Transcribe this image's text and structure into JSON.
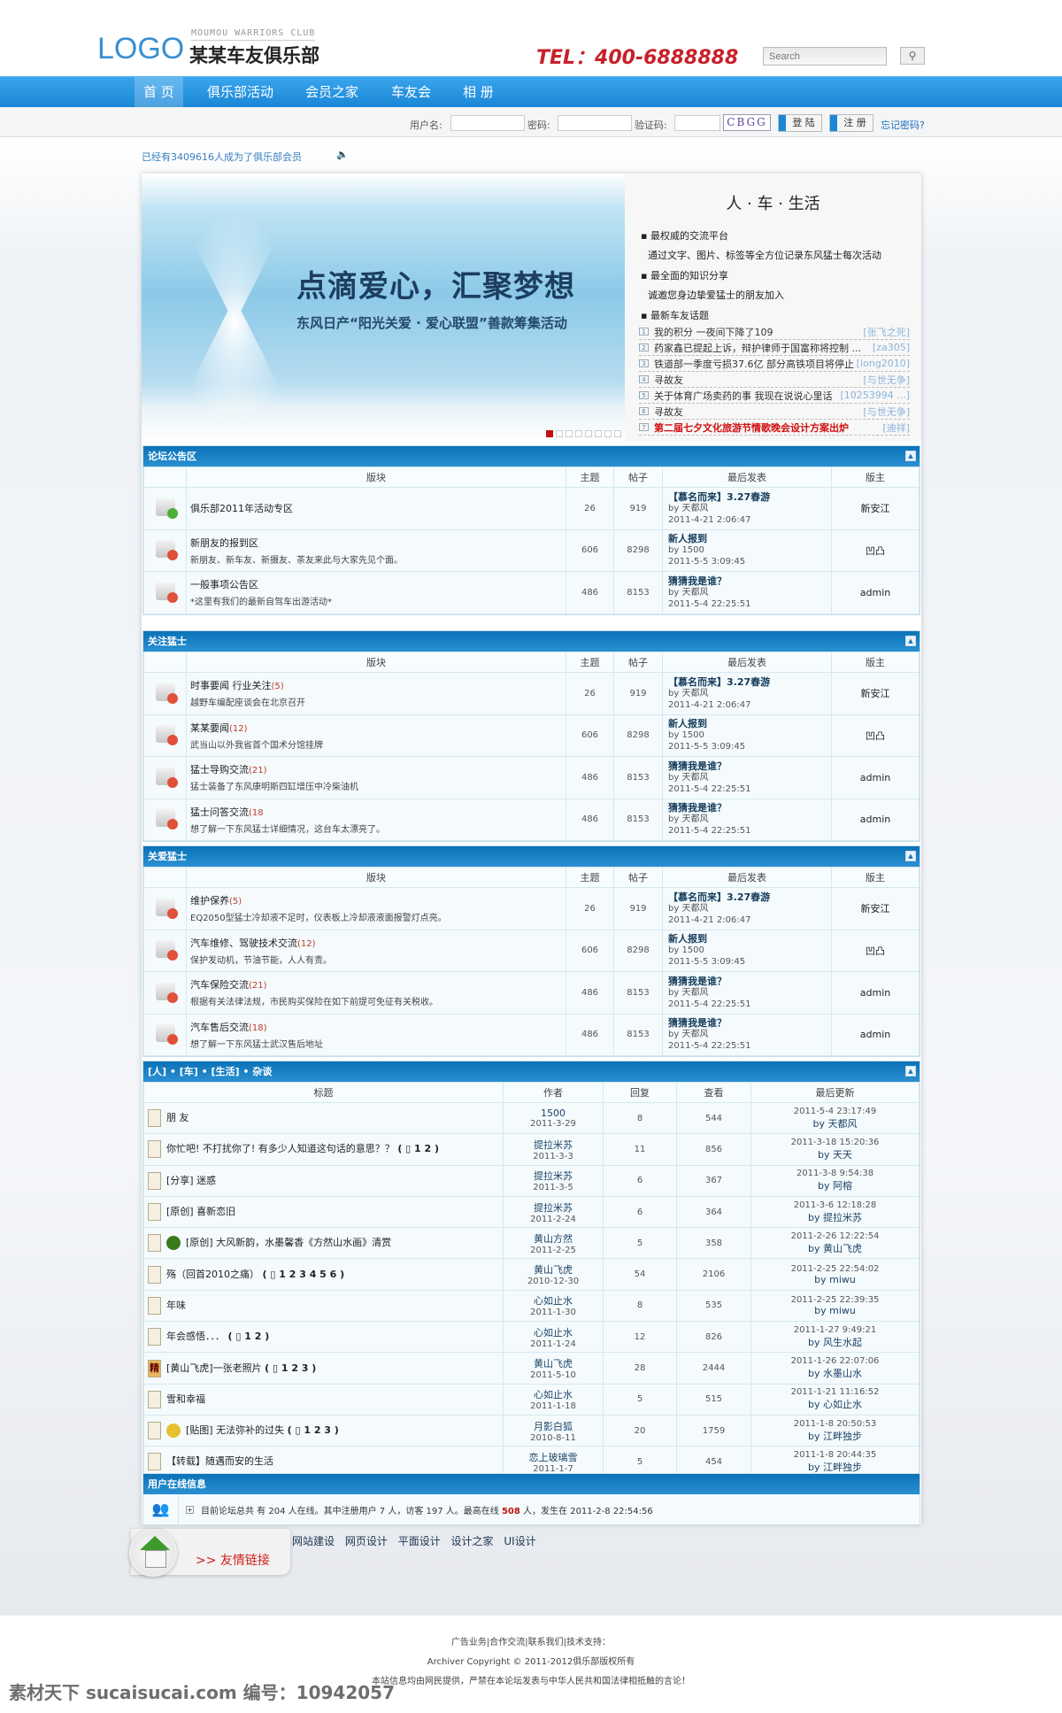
{
  "header": {
    "logo": "LOGO",
    "club_en": "MOUMOU WARRIORS CLUB",
    "club_cn": "某某车友俱乐部",
    "tel": "TEL：400-6888888",
    "search_placeholder": "Search"
  },
  "nav": [
    {
      "label": "首 页",
      "active": true
    },
    {
      "label": "俱乐部活动"
    },
    {
      "label": "会员之家"
    },
    {
      "label": "车友会"
    },
    {
      "label": "相 册"
    }
  ],
  "login": {
    "username_label": "用户名:",
    "password_label": "密码:",
    "captcha_label": "验证码:",
    "captcha": "CBGG",
    "login_btn": "登 陆",
    "register_btn": "注 册",
    "forgot": "忘记密码?"
  },
  "members_text": "已经有3409616人成为了俱乐部会员",
  "banner": {
    "title": "点滴爱心，汇聚梦想",
    "subtitle": "东风日产“阳光关爱 · 爱心联盟”善款筹集活动",
    "slides": 8,
    "active_slide": 1
  },
  "side": {
    "title": "人 · 车 · 生活",
    "b1": "最权威的交流平台",
    "t1": "通过文字、图片、标签等全方位记录东风猛士每次活动",
    "b2": "最全面的知识分享",
    "t2": "诚邀您身边挚爱猛士的朋友加入",
    "b3": "最新车友话题",
    "topics": [
      {
        "n": "1",
        "title": "我的积分 一夜间下降了109",
        "user": "[张飞之死]"
      },
      {
        "n": "2",
        "title": "药家鑫已提起上诉，辩护律师于国富称将控制 ...",
        "user": "[za305]"
      },
      {
        "n": "3",
        "title": "铁道部一季度亏损37.6亿 部分高铁项目将停止 ...",
        "user": "[long2010]"
      },
      {
        "n": "4",
        "title": "寻故友",
        "user": "[与世无争]"
      },
      {
        "n": "5",
        "title": "关于体育广场卖药的事 我现在说说心里话",
        "user": "[10253994 ...]"
      },
      {
        "n": "6",
        "title": "寻故友",
        "user": "[与世无争]"
      },
      {
        "n": "7",
        "title": "第二届七夕文化旅游节情歌晚会设计方案出炉",
        "user": "[迪祥]",
        "highlight": true
      }
    ]
  },
  "forum_headers": [
    "版块",
    "主题",
    "帖子",
    "最后发表",
    "版主"
  ],
  "sections": [
    {
      "title": "论坛公告区",
      "rows": [
        {
          "icon": "green",
          "name": "俱乐部2011年活动专区",
          "count": "",
          "desc": "",
          "topics": "26",
          "posts": "919",
          "last_title": "【慕名而来】3.27春游",
          "last_by": "by 天都风",
          "last_time": "2011-4-21 2:06:47",
          "mod": "新安江"
        },
        {
          "icon": "red",
          "name": "新朋友的报到区",
          "count": "",
          "desc": "新朋友、新车友、新摄友、茶友来此与大家先见个面。",
          "topics": "606",
          "posts": "8298",
          "last_title": "新人报到",
          "last_by": "by 1500",
          "last_time": "2011-5-5 3:09:45",
          "mod": "凹凸"
        },
        {
          "icon": "red",
          "name": "一般事项公告区",
          "count": "",
          "desc": "*这里有我们的最新自驾车出游活动*",
          "topics": "486",
          "posts": "8153",
          "last_title": "猜猜我是谁？",
          "last_by": "by 天都风",
          "last_time": "2011-5-4 22:25:51",
          "mod": "admin"
        }
      ]
    },
    {
      "title": "关注猛士",
      "rows": [
        {
          "icon": "red",
          "name": "时事要闻  行业关注",
          "count": "(5)",
          "desc": "越野车编配座谈会在北京召开",
          "topics": "26",
          "posts": "919",
          "last_title": "【慕名而来】3.27春游",
          "last_by": "by 天都风",
          "last_time": "2011-4-21 2:06:47",
          "mod": "新安江"
        },
        {
          "icon": "red",
          "name": "某某要闻",
          "count": "(12)",
          "desc": "武当山以外我省首个国术分馆挂牌",
          "topics": "606",
          "posts": "8298",
          "last_title": "新人报到",
          "last_by": "by 1500",
          "last_time": "2011-5-5 3:09:45",
          "mod": "凹凸"
        },
        {
          "icon": "red",
          "name": "猛士导购交流",
          "count": "(21)",
          "desc": "猛士装备了东风康明斯四缸增压中冷柴油机",
          "topics": "486",
          "posts": "8153",
          "last_title": "猜猜我是谁？",
          "last_by": "by 天都风",
          "last_time": "2011-5-4 22:25:51",
          "mod": "admin"
        },
        {
          "icon": "red",
          "name": "猛士问答交流",
          "count": "(18",
          "desc": "想了解一下东风猛士详细情况，这台车太漂亮了。",
          "topics": "486",
          "posts": "8153",
          "last_title": "猜猜我是谁？",
          "last_by": "by 天都风",
          "last_time": "2011-5-4 22:25:51",
          "mod": "admin"
        }
      ]
    },
    {
      "title": "关爱猛士",
      "rows": [
        {
          "icon": "red",
          "name": "维护保养",
          "count": "(5)",
          "desc": "EQ2050型猛士冷却液不足时，仪表板上冷却液液面报警灯点亮。",
          "topics": "26",
          "posts": "919",
          "last_title": "【慕名而来】3.27春游",
          "last_by": "by 天都风",
          "last_time": "2011-4-21 2:06:47",
          "mod": "新安江"
        },
        {
          "icon": "red",
          "name": "汽车维修、驾驶技术交流",
          "count": "(12)",
          "desc": "保护发动机，节油节能，人人有责。",
          "topics": "606",
          "posts": "8298",
          "last_title": "新人报到",
          "last_by": "by 1500",
          "last_time": "2011-5-5 3:09:45",
          "mod": "凹凸"
        },
        {
          "icon": "red",
          "name": "汽车保险交流",
          "count": "(21)",
          "desc": "根据有关法律法规，市民购买保险在如下前提可免征有关税收。",
          "topics": "486",
          "posts": "8153",
          "last_title": "猜猜我是谁？",
          "last_by": "by 天都风",
          "last_time": "2011-5-4 22:25:51",
          "mod": "admin"
        },
        {
          "icon": "red",
          "name": "汽车售后交流",
          "count": "(18)",
          "desc": "想了解一下东风猛士武汉售后地址",
          "topics": "486",
          "posts": "8153",
          "last_title": "猜猜我是谁？",
          "last_by": "by 天都风",
          "last_time": "2011-5-4 22:25:51",
          "mod": "admin"
        }
      ]
    }
  ],
  "talk": {
    "title": "[人] • [车] • [生活] • 杂谈",
    "headers": [
      "标题",
      "作者",
      "回复",
      "查看",
      "最后更新"
    ],
    "rows": [
      {
        "icon": "doc",
        "emo": "",
        "title": "朋 友",
        "pages": "",
        "author": "1500",
        "date": "2011-3-29",
        "replies": "8",
        "views": "544",
        "upd": "2011-5-4 23:17:49",
        "by": "by 天都风"
      },
      {
        "icon": "doc",
        "emo": "",
        "title": "你忙吧! 不打扰你了!  有多少人知道这句话的意思？？",
        "pages": "( ▯ 1 2 )",
        "author": "提拉米苏",
        "date": "2011-3-3",
        "replies": "11",
        "views": "856",
        "upd": "2011-3-18 15:20:36",
        "by": "by 天天"
      },
      {
        "icon": "doc",
        "emo": "",
        "title": "[分享] 迷惑",
        "pages": "",
        "author": "提拉米苏",
        "date": "2011-3-5",
        "replies": "6",
        "views": "367",
        "upd": "2011-3-8 9:54:38",
        "by": "by 阿榕"
      },
      {
        "icon": "doc",
        "emo": "",
        "title": "[原创] 喜新恋旧",
        "pages": "",
        "author": "提拉米苏",
        "date": "2011-2-24",
        "replies": "6",
        "views": "364",
        "upd": "2011-3-6 12:18:28",
        "by": "by 提拉米苏"
      },
      {
        "icon": "doc",
        "emo": "hat",
        "title": "[原创] 大风新韵，水墨馨香《方然山水画》清赏",
        "pages": "",
        "author": "黄山方然",
        "date": "2011-2-25",
        "replies": "5",
        "views": "358",
        "upd": "2011-2-26 12:22:54",
        "by": "by 黄山飞虎"
      },
      {
        "icon": "doc",
        "emo": "",
        "title": "殇（回首2010之痛）",
        "pages": "( ▯ 1 2 3 4 5 6 )",
        "author": "黄山飞虎",
        "date": "2010-12-30",
        "replies": "54",
        "views": "2106",
        "upd": "2011-2-25 22:54:02",
        "by": "by miwu"
      },
      {
        "icon": "doc",
        "emo": "",
        "title": "年味",
        "pages": "",
        "author": "心如止水",
        "date": "2011-1-30",
        "replies": "8",
        "views": "535",
        "upd": "2011-2-25 22:39:35",
        "by": "by miwu"
      },
      {
        "icon": "doc",
        "emo": "",
        "title": "年会感悟．．．",
        "pages": "( ▯ 1 2 )",
        "author": "心如止水",
        "date": "2011-1-24",
        "replies": "12",
        "views": "826",
        "upd": "2011-1-27 9:49:21",
        "by": "by 风生水起"
      },
      {
        "icon": "jing",
        "emo": "",
        "title": "[黄山飞虎]一张老照片",
        "pages": "( ▯ 1 2 3 )",
        "author": "黄山飞虎",
        "date": "2011-5-10",
        "replies": "28",
        "views": "2444",
        "upd": "2011-1-26 22:07:06",
        "by": "by 水墨山水"
      },
      {
        "icon": "doc",
        "emo": "",
        "title": "雪和幸福",
        "pages": "",
        "author": "心如止水",
        "date": "2011-1-18",
        "replies": "5",
        "views": "515",
        "upd": "2011-1-21 11:16:52",
        "by": "by 心如止水"
      },
      {
        "icon": "doc",
        "emo": "smile",
        "title": "[贴图] 无法弥补的过失",
        "pages": "( ▯ 1 2 3 )",
        "author": "月影白狐",
        "date": "2010-8-11",
        "replies": "20",
        "views": "1759",
        "upd": "2011-1-8 20:50:53",
        "by": "by 江畔独步"
      },
      {
        "icon": "doc",
        "emo": "",
        "title": "【转载】随遇而安的生活",
        "pages": "",
        "author": "恋上玻璃雪",
        "date": "2011-1-7",
        "replies": "5",
        "views": "454",
        "upd": "2011-1-8 20:44:35",
        "by": "by 江畔独步"
      }
    ]
  },
  "online": {
    "title": "用户在线信息",
    "pre": "目前论坛总共 有 204 人在线。其中注册用户 7 人，访客 197 人。最高在线 ",
    "max": "508",
    "post": " 人，发生在 2011-2-8 22:54:56"
  },
  "friend_links": {
    "label": ">> 友情链接",
    "links": [
      "网站建设",
      "网页设计",
      "平面设计",
      "设计之家",
      "UI设计"
    ]
  },
  "footer": {
    "line1": "广告业务|合作交流|联系我们|技术支持：",
    "line2": "Archiver Copyright © 2011-2012俱乐部版权所有",
    "line3": "本站信息均由网民提供，严禁在本论坛发表与中华人民共和国法律相抵触的言论！"
  },
  "watermark": "素材天下 sucaisucai.com  编号：10942057"
}
